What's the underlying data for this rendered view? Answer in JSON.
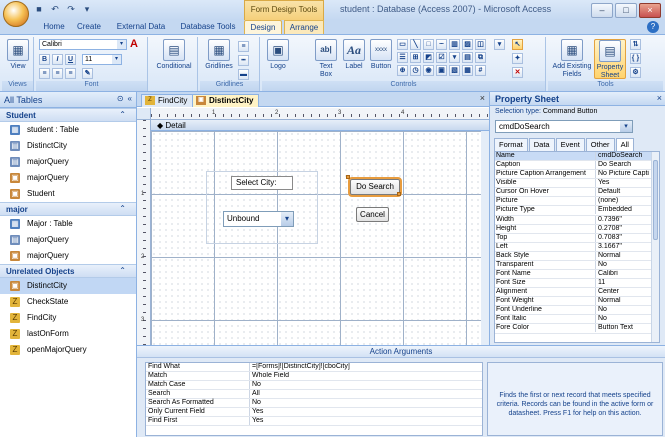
{
  "window": {
    "title": "student : Database (Access 2007) - Microsoft Access",
    "contextual_tab_group": "Form Design Tools",
    "minimize": "–",
    "maximize": "□",
    "close": "×"
  },
  "qat": [
    "save-icon",
    "undo-icon",
    "redo-icon",
    "customize-icon"
  ],
  "ribbon_tabs": [
    {
      "label": "Home"
    },
    {
      "label": "Create"
    },
    {
      "label": "External Data"
    },
    {
      "label": "Database Tools"
    },
    {
      "label": "Design"
    },
    {
      "label": "Arrange"
    }
  ],
  "ribbon": {
    "views": {
      "label": "Views",
      "view_button": "View"
    },
    "font": {
      "label": "Font",
      "font_name": "Calibri",
      "font_size": "11",
      "bold": "B",
      "italic": "I",
      "underline": "U",
      "font_color_glyph": "A"
    },
    "conditional": "Conditional",
    "gridlines": {
      "label": "Gridlines",
      "button": "Gridlines"
    },
    "controls": {
      "label": "Controls",
      "logo": "Logo",
      "text_box": "Text Box",
      "label_btn": "Label",
      "label_glyph": "Aa",
      "textbox_glyph": "ab|",
      "button": "Button",
      "button_glyph": "xxxx"
    },
    "tools": {
      "label": "Tools",
      "add_existing_fields": "Add Existing Fields",
      "property_sheet": "Property Sheet"
    }
  },
  "nav": {
    "title": "All Tables",
    "groups": [
      {
        "title": "Student",
        "items": [
          {
            "label": "student : Table",
            "type": "table"
          },
          {
            "label": "DistinctCity",
            "type": "query"
          },
          {
            "label": "majorQuery",
            "type": "query"
          },
          {
            "label": "majorQuery",
            "type": "form"
          },
          {
            "label": "Student",
            "type": "form"
          }
        ]
      },
      {
        "title": "major",
        "items": [
          {
            "label": "Major : Table",
            "type": "table"
          },
          {
            "label": "majorQuery",
            "type": "query"
          },
          {
            "label": "majorQuery",
            "type": "form"
          }
        ]
      },
      {
        "title": "Unrelated Objects",
        "items": [
          {
            "label": "DistinctCity",
            "type": "form",
            "selected": true
          },
          {
            "label": "CheckState",
            "type": "macro"
          },
          {
            "label": "FindCity",
            "type": "macro"
          },
          {
            "label": "lastOnForm",
            "type": "macro"
          },
          {
            "label": "openMajorQuery",
            "type": "macro"
          }
        ]
      }
    ]
  },
  "document": {
    "tabs": [
      {
        "label": "FindCity",
        "active": false
      },
      {
        "label": "DistinctCity",
        "active": true
      }
    ],
    "close": "×",
    "section": "Detail",
    "ruler_h": [
      "1",
      "2",
      "3",
      "4"
    ],
    "ruler_v": [
      "1",
      "2",
      "3"
    ],
    "controls": {
      "label_select_city": "Select City:",
      "combo_value": "Unbound",
      "btn_search": "Do Search",
      "btn_cancel": "Cancel"
    }
  },
  "action_args": {
    "title": "Action Arguments",
    "rows": [
      {
        "k": "Find What",
        "v": "=[Forms]![DistinctCity]![cboCity]"
      },
      {
        "k": "Match",
        "v": "Whole Field"
      },
      {
        "k": "Match Case",
        "v": "No"
      },
      {
        "k": "Search",
        "v": "All"
      },
      {
        "k": "Search As Formatted",
        "v": "No"
      },
      {
        "k": "Only Current Field",
        "v": "Yes"
      },
      {
        "k": "Find First",
        "v": "Yes"
      }
    ],
    "help": "Finds the first or next record that meets specified criteria. Records can be found in the active form or datasheet. Press F1 for help on this action."
  },
  "property_sheet": {
    "title": "Property Sheet",
    "close": "×",
    "selection_type_label": "Selection type:",
    "selection_type_value": "Command Button",
    "selected_object": "cmdDoSearch",
    "tabs": [
      "Format",
      "Data",
      "Event",
      "Other",
      "All"
    ],
    "active_tab": "All",
    "rows": [
      {
        "k": "Name",
        "v": "cmdDoSearch"
      },
      {
        "k": "Caption",
        "v": "Do Search"
      },
      {
        "k": "Picture Caption Arrangement",
        "v": "No Picture Capti"
      },
      {
        "k": "Visible",
        "v": "Yes"
      },
      {
        "k": "Cursor On Hover",
        "v": "Default"
      },
      {
        "k": "Picture",
        "v": "(none)"
      },
      {
        "k": "Picture Type",
        "v": "Embedded"
      },
      {
        "k": "Width",
        "v": "0.7396\""
      },
      {
        "k": "Height",
        "v": "0.2708\""
      },
      {
        "k": "Top",
        "v": "0.7083\""
      },
      {
        "k": "Left",
        "v": "3.1667\""
      },
      {
        "k": "Back Style",
        "v": "Normal"
      },
      {
        "k": "Transparent",
        "v": "No"
      },
      {
        "k": "Font Name",
        "v": "Calibri"
      },
      {
        "k": "Font Size",
        "v": "11"
      },
      {
        "k": "Alignment",
        "v": "Center"
      },
      {
        "k": "Font Weight",
        "v": "Normal"
      },
      {
        "k": "Font Underline",
        "v": "No"
      },
      {
        "k": "Font Italic",
        "v": "No"
      },
      {
        "k": "Fore Color",
        "v": "Button Text"
      }
    ]
  }
}
